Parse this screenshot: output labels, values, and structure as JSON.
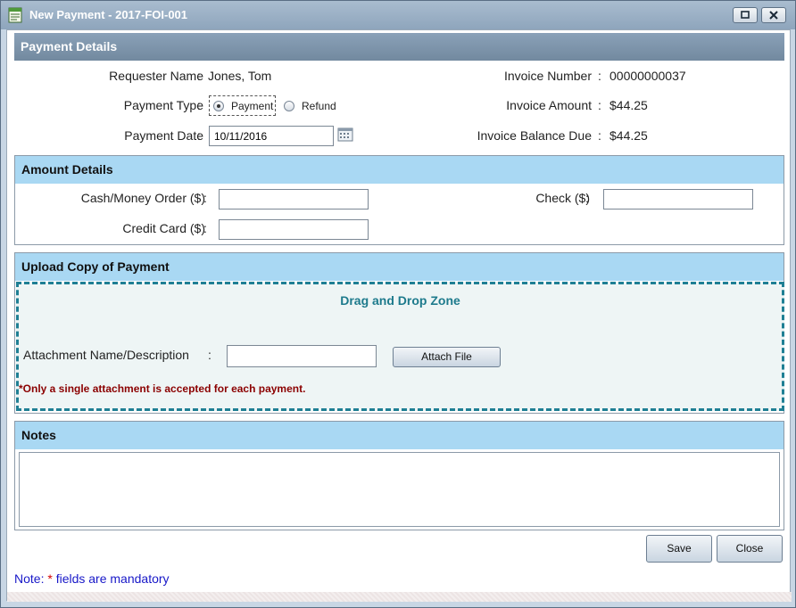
{
  "window": {
    "title": "New Payment - 2017-FOI-001",
    "icons": {
      "app": "form-icon",
      "restore": "restore-icon",
      "close": "close-icon"
    }
  },
  "payment_details": {
    "header": "Payment Details",
    "requester_label": "Requester Name",
    "requester_value": "Jones, Tom",
    "payment_type_label": "Payment Type",
    "payment_type_options": [
      "Payment",
      "Refund"
    ],
    "payment_type_selected": "Payment",
    "payment_date_label": "Payment Date",
    "payment_date_value": "10/11/2016",
    "invoice_number_label": "Invoice Number",
    "invoice_number_value": "00000000037",
    "invoice_amount_label": "Invoice Amount",
    "invoice_amount_value": "$44.25",
    "invoice_balance_label": "Invoice Balance Due",
    "invoice_balance_value": "$44.25",
    "separator": ":"
  },
  "amount_details": {
    "header": "Amount Details",
    "cash_label": "Cash/Money Order ($)",
    "check_label": "Check ($)",
    "credit_label": "Credit Card ($)",
    "cash_value": "",
    "check_value": "",
    "credit_value": ""
  },
  "upload": {
    "header": "Upload Copy of Payment",
    "drop_zone_title": "Drag and Drop Zone",
    "attachment_label": "Attachment Name/Description",
    "attachment_value": "",
    "attach_button": "Attach File",
    "warning": "*Only a single attachment is accepted for each payment."
  },
  "notes": {
    "header": "Notes",
    "value": ""
  },
  "actions": {
    "save": "Save",
    "close": "Close"
  },
  "footer": {
    "prefix": "Note: ",
    "star": "*",
    "text": " fields are mandatory"
  },
  "colors": {
    "dark_header": "#7f96ad",
    "light_header": "#a9d8f3",
    "drop_zone_border": "#1f7f94",
    "warning": "#8b0000",
    "note_text": "#1818c8",
    "required_star": "#d40000"
  }
}
